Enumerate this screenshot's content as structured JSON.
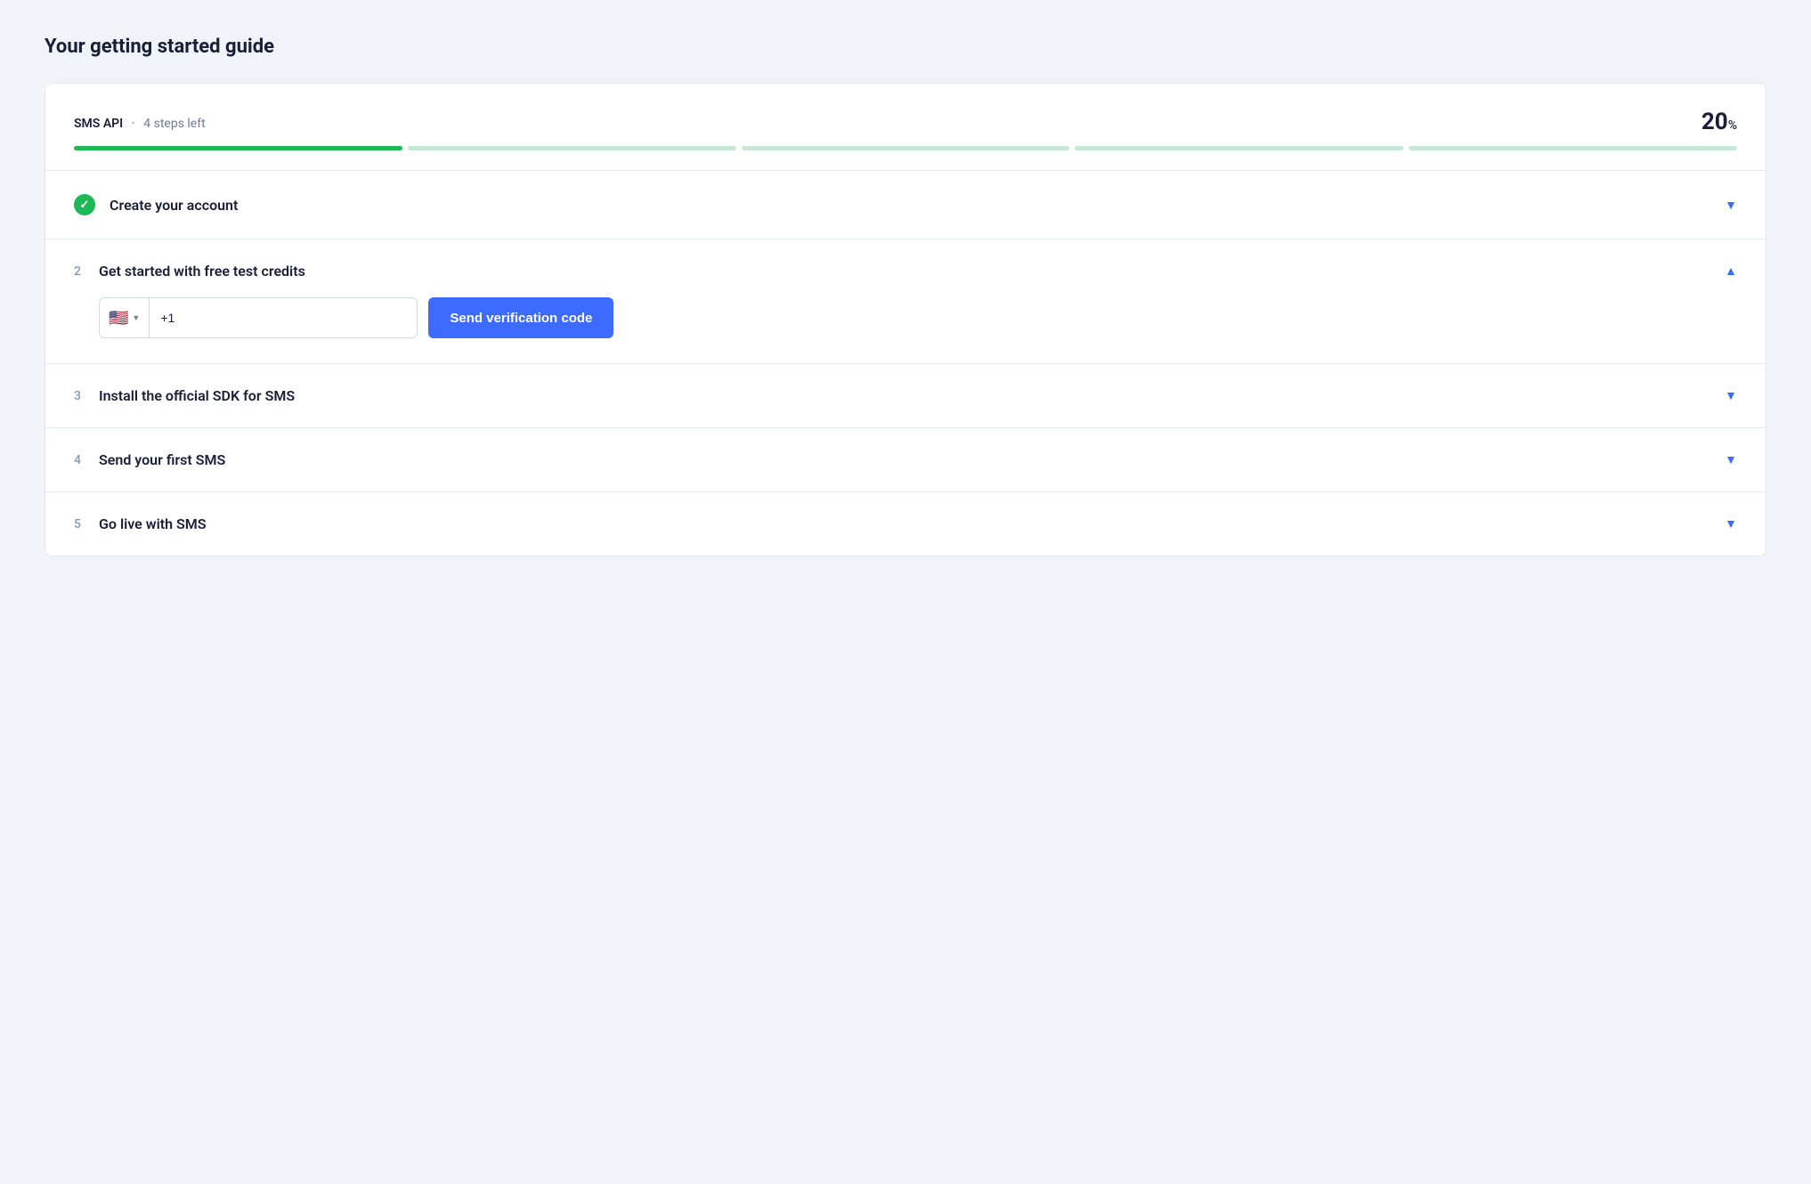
{
  "page": {
    "title": "Your getting started guide"
  },
  "progress": {
    "api_label": "SMS API",
    "separator": "·",
    "steps_left": "4 steps left",
    "percent": "20",
    "percent_sign": "%",
    "filled_segments": 1,
    "total_segments": 5
  },
  "steps": [
    {
      "id": "create-account",
      "number": "",
      "title": "Create your account",
      "completed": true,
      "expanded": false,
      "chevron": "▼"
    },
    {
      "id": "free-test-credits",
      "number": "2",
      "title": "Get started with free test credits",
      "completed": false,
      "expanded": true,
      "chevron": "▲"
    },
    {
      "id": "install-sdk",
      "number": "3",
      "title": "Install the official SDK for SMS",
      "completed": false,
      "expanded": false,
      "chevron": "▼"
    },
    {
      "id": "send-first-sms",
      "number": "4",
      "title": "Send your first SMS",
      "completed": false,
      "expanded": false,
      "chevron": "▼"
    },
    {
      "id": "go-live",
      "number": "5",
      "title": "Go live with SMS",
      "completed": false,
      "expanded": false,
      "chevron": "▼"
    }
  ],
  "phone_input": {
    "flag_emoji": "🇺🇸",
    "prefix": "+1",
    "placeholder": ""
  },
  "send_button": {
    "label": "Send verification code"
  }
}
